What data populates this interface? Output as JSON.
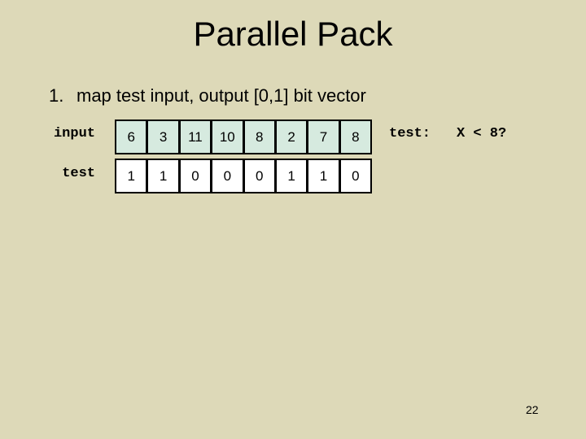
{
  "slide": {
    "title": "Parallel Pack",
    "bullets": [
      {
        "number": "1.",
        "text": "map test input, output [0,1] bit vector"
      }
    ],
    "rows": {
      "input": {
        "label": "input",
        "values": [
          "6",
          "3",
          "11",
          "10",
          "8",
          "2",
          "7",
          "8"
        ],
        "fill_color": "#d6eadf"
      },
      "test": {
        "label": "test",
        "values": [
          "1",
          "1",
          "0",
          "0",
          "0",
          "1",
          "1",
          "0"
        ],
        "fill_color": "#ffffff"
      }
    },
    "test_label": "test:",
    "test_expression": "X < 8?",
    "page_number": "22",
    "background_color": "#ddd9b8"
  }
}
